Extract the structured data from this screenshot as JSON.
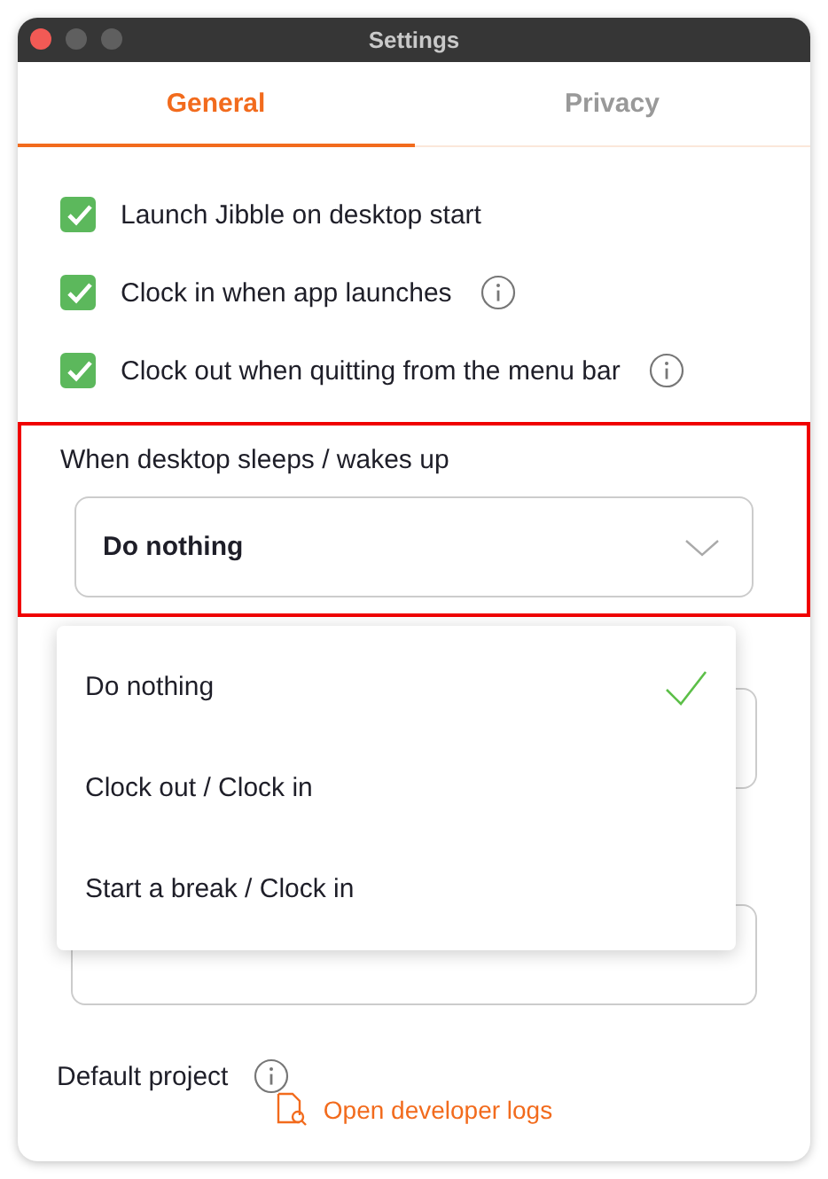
{
  "window": {
    "title": "Settings"
  },
  "tabs": [
    {
      "label": "General",
      "selected": true
    },
    {
      "label": "Privacy",
      "selected": false
    }
  ],
  "options": [
    {
      "label": "Launch Jibble on desktop start",
      "checked": true,
      "info": false
    },
    {
      "label": "Clock in when app launches",
      "checked": true,
      "info": true
    },
    {
      "label": "Clock out when quitting from the menu bar",
      "checked": true,
      "info": true
    }
  ],
  "sleep_setting": {
    "label": "When desktop sleeps / wakes up",
    "value": "Do nothing",
    "highlighted": true
  },
  "dropdown_menu": {
    "items": [
      {
        "label": "Do nothing",
        "selected": true
      },
      {
        "label": "Clock out / Clock in",
        "selected": false
      },
      {
        "label": "Start a break / Clock in",
        "selected": false
      }
    ]
  },
  "default_project": {
    "label": "Default project"
  },
  "developer_logs_link": "Open developer logs"
}
